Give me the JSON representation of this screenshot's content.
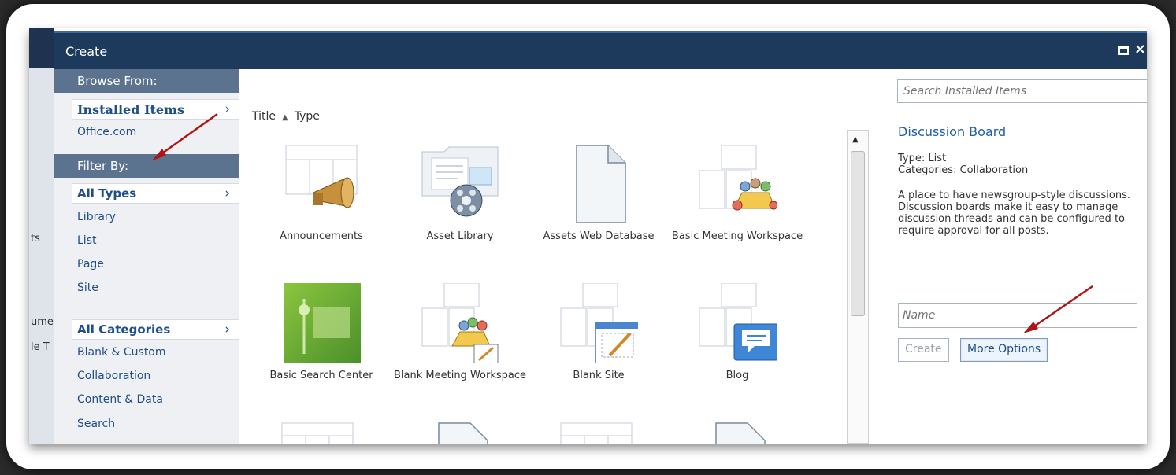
{
  "background_page": {
    "fragments": [
      "ts",
      "ume",
      "le T"
    ]
  },
  "dialog": {
    "title": "Create"
  },
  "nav": {
    "browse_heading": "Browse From:",
    "browse_selected": "Installed Items",
    "browse_items": [
      "Office.com"
    ],
    "filter_heading": "Filter By:",
    "types_selected": "All Types",
    "type_items": [
      "Library",
      "List",
      "Page",
      "Site"
    ],
    "categories_selected": "All Categories",
    "category_items": [
      "Blank & Custom",
      "Collaboration",
      "Content & Data",
      "Search"
    ]
  },
  "gallery": {
    "sort_title": "Title",
    "sort_type": "Type",
    "items": [
      {
        "label": "Announcements",
        "icon": "megaphone-icon"
      },
      {
        "label": "Asset Library",
        "icon": "asset-library-icon"
      },
      {
        "label": "Assets Web Database",
        "icon": "document-icon"
      },
      {
        "label": "Basic Meeting Workspace",
        "icon": "meeting-workspace-icon"
      },
      {
        "label": "Basic Search Center",
        "icon": "search-center-icon"
      },
      {
        "label": "Blank Meeting Workspace",
        "icon": "blank-meeting-workspace-icon"
      },
      {
        "label": "Blank Site",
        "icon": "blank-site-icon"
      },
      {
        "label": "Blog",
        "icon": "blog-icon"
      }
    ]
  },
  "details": {
    "search_placeholder": "Search Installed Items",
    "title": "Discussion Board",
    "type_line": "Type: List",
    "categories_line": "Categories: Collaboration",
    "description": "A place to have newsgroup-style discussions.  Discussion boards make it easy to manage discussion threads and can be configured to require approval for all posts.",
    "name_placeholder": "Name",
    "create_label": "Create",
    "more_options_label": "More Options"
  }
}
